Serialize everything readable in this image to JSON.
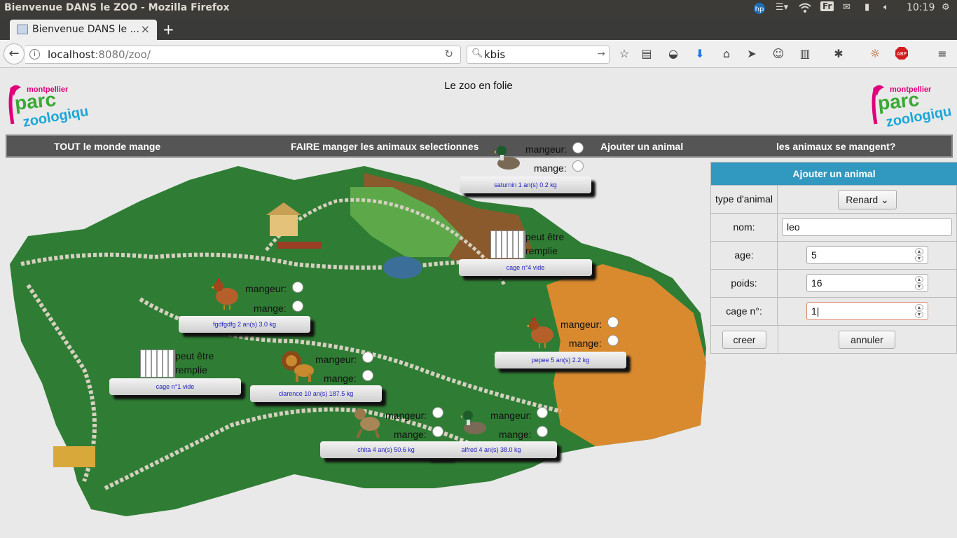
{
  "os": {
    "window_title": "Bienvenue DANS le ZOO - Mozilla Firefox",
    "keyboard_layout": "Fr",
    "clock": "10:19"
  },
  "browser": {
    "tab_title": "Bienvenue DANS le ...",
    "url_host": "localhost",
    "url_rest": ":8080/zoo/",
    "search_value": "kbis"
  },
  "page": {
    "title": "Le zoo en folie",
    "logo": {
      "line1": "montpellier",
      "line2": "parc",
      "line3": "zoologique"
    }
  },
  "menu": {
    "everyone_eats": "TOUT le monde mange",
    "feed_selected": "FAIRE manger les animaux selectionnes",
    "add_animal": "Ajouter un animal",
    "animals_eat_each_other": "les animaux se mangent?"
  },
  "labels": {
    "eater": "mangeur:",
    "eats": "mange:",
    "cage_fillable_1": "peut être",
    "cage_fillable_2": "remplie"
  },
  "animals": [
    {
      "name": "saturnin",
      "species_icon": "duck-icon",
      "info": "saturnin 1 an(s) 0.2 kg"
    },
    {
      "name": "fgdfgdfg",
      "species_icon": "hen-icon",
      "info": "fgdfgdfg 2 an(s) 3.0 kg"
    },
    {
      "name": "pepee",
      "species_icon": "hen-icon",
      "info": "pepee 5 an(s) 2.2 kg"
    },
    {
      "name": "clarence",
      "species_icon": "lion-icon",
      "info": "clarence 10 an(s) 187.5 kg"
    },
    {
      "name": "chita",
      "species_icon": "monkey-icon",
      "info": "chita 4 an(s) 50.6 kg"
    },
    {
      "name": "alfred",
      "species_icon": "duck-icon",
      "info": "alfred 4 an(s) 38.0 kg"
    }
  ],
  "cages": [
    {
      "info": "cage n°4 vide"
    },
    {
      "info": "cage n°1 vide"
    }
  ],
  "form": {
    "header": "Ajouter un animal",
    "type_label": "type d'animal",
    "type_value": "Renard",
    "name_label": "nom:",
    "name_value": "leo",
    "age_label": "age:",
    "age_value": "5",
    "weight_label": "poids:",
    "weight_value": "16",
    "cage_label": "cage n°:",
    "cage_value": "1",
    "create_button": "creer",
    "cancel_button": "annuler"
  },
  "colors": {
    "form_header": "#3198c0",
    "menu_bg": "#555555",
    "plaque_text": "#1d1dc0",
    "logo_pink": "#e0007a",
    "logo_green": "#3aa935",
    "logo_blue": "#1aa6d8"
  }
}
